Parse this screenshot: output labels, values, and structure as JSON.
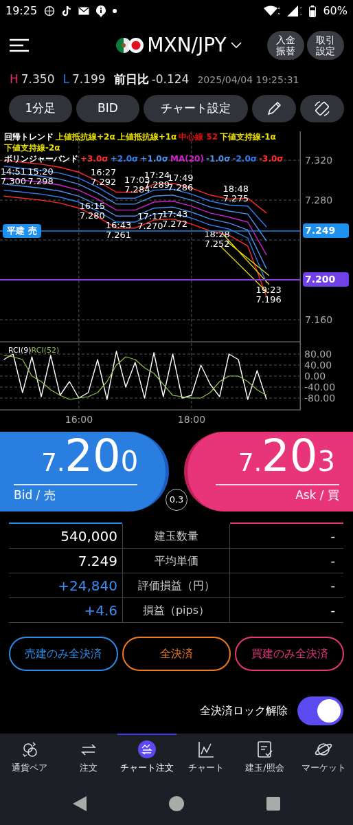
{
  "status_bar": {
    "time": "19:25",
    "battery": "60%"
  },
  "header": {
    "pair": "MXN/JPY",
    "buttons": [
      "入金振替",
      "取引設定"
    ]
  },
  "quote": {
    "high_label": "H",
    "high": "7.350",
    "low_label": "L",
    "low": "7.199",
    "change_label": "前日比",
    "change": "-0.124",
    "timestamp": "2025/04/04 19:25:31"
  },
  "toolbar": [
    {
      "kind": "text",
      "label": "1分足"
    },
    {
      "kind": "text",
      "label": "BID"
    },
    {
      "kind": "text",
      "label": "チャート設定"
    },
    {
      "kind": "pencil"
    },
    {
      "kind": "rotate"
    }
  ],
  "chart": {
    "legend_top": [
      {
        "text": "回帰トレンド",
        "color": "#ffffff"
      },
      {
        "text": "上値抵抗線+2α",
        "color": "#e8e000"
      },
      {
        "text": "上値抵抗線+1α",
        "color": "#e8e000"
      },
      {
        "text": "中心線 52",
        "color": "#e01010"
      },
      {
        "text": "下値支持線-1α",
        "color": "#e8e000"
      }
    ],
    "legend_second": {
      "text": "下値支持線-2α",
      "color": "#e8e000"
    },
    "bands_title": {
      "text": "ボリンジャーバンド",
      "color": "#ffffff"
    },
    "annotations": [
      {
        "kind": "high",
        "time": "14:51",
        "price": "7.300"
      },
      {
        "kind": "high",
        "time": "15:20",
        "price": "7.298"
      },
      {
        "kind": "high",
        "time": "16:27",
        "price": "7.292"
      },
      {
        "kind": "low",
        "time": "16:15",
        "price": "7.280"
      },
      {
        "kind": "low",
        "time": "16:43",
        "price": "7.261"
      },
      {
        "kind": "high",
        "time": "17:03",
        "price": "7.284"
      },
      {
        "kind": "high",
        "time": "17:24",
        "price": "7.289"
      },
      {
        "kind": "low",
        "time": "17:17",
        "price": "7.270"
      },
      {
        "kind": "high",
        "time": "17:49",
        "price": "7.286"
      },
      {
        "kind": "low",
        "time": "17:43",
        "price": "7.272"
      },
      {
        "kind": "high",
        "time": "18:48",
        "price": "7.275"
      },
      {
        "kind": "low",
        "time": "18:28",
        "price": "7.252"
      },
      {
        "kind": "low",
        "time": "19:23",
        "price": "7.196"
      }
    ],
    "price_chart": {
      "chart_data": {
        "type": "line",
        "xlim": [
          14.6,
          19.93
        ],
        "ylim": [
          7.138,
          7.349
        ],
        "x": [
          14.667,
          15,
          15.333,
          15.667,
          16,
          16.333,
          16.667,
          17,
          17.333,
          17.667,
          18,
          18.333,
          18.667,
          19,
          19.333
        ],
        "yticks": [
          {
            "value": 7.32,
            "label": "7.320"
          },
          {
            "value": 7.28,
            "label": "7.280"
          },
          {
            "value": 7.16,
            "label": "7.160"
          }
        ],
        "series": [
          {
            "name": "+3.0σ",
            "color": "#ff2a2a",
            "values": [
              7.32,
              7.318,
              7.316,
              7.313,
              7.308,
              7.299,
              7.288,
              7.288,
              7.296,
              7.297,
              7.292,
              7.285,
              7.281,
              7.282,
              7.267
            ]
          },
          {
            "name": "+2.0σ",
            "color": "#2f7df0",
            "values": [
              7.314,
              7.312,
              7.31,
              7.307,
              7.302,
              7.293,
              7.282,
              7.282,
              7.29,
              7.291,
              7.286,
              7.279,
              7.275,
              7.274,
              7.253
            ]
          },
          {
            "name": "+1.0σ",
            "color": "#4a90e8",
            "values": [
              7.308,
              7.306,
              7.304,
              7.301,
              7.296,
              7.287,
              7.276,
              7.276,
              7.284,
              7.285,
              7.28,
              7.273,
              7.269,
              7.266,
              7.239
            ]
          },
          {
            "name": "MA(20)",
            "color": "#d020d0",
            "values": [
              7.302,
              7.3,
              7.298,
              7.295,
              7.29,
              7.281,
              7.27,
              7.27,
              7.278,
              7.279,
              7.274,
              7.267,
              7.263,
              7.258,
              7.225
            ]
          },
          {
            "name": "-1.0σ",
            "color": "#4a90e8",
            "values": [
              7.296,
              7.294,
              7.292,
              7.289,
              7.284,
              7.275,
              7.264,
              7.264,
              7.272,
              7.273,
              7.268,
              7.261,
              7.257,
              7.25,
              7.211
            ]
          },
          {
            "name": "-2.0σ",
            "color": "#2f7df0",
            "values": [
              7.29,
              7.288,
              7.286,
              7.283,
              7.278,
              7.269,
              7.258,
              7.258,
              7.266,
              7.267,
              7.262,
              7.255,
              7.251,
              7.242,
              7.197
            ]
          },
          {
            "name": "-3.0σ",
            "color": "#ff2a2a",
            "values": [
              7.284,
              7.282,
              7.28,
              7.277,
              7.272,
              7.263,
              7.252,
              7.252,
              7.26,
              7.261,
              7.256,
              7.249,
              7.245,
              7.234,
              7.183
            ]
          }
        ]
      }
    },
    "position_line": {
      "label": "平建 売",
      "price": "7.249"
    },
    "current_price": "7.200",
    "rci_chart": {
      "chart_data": {
        "type": "line",
        "x": [
          14.667,
          14.833,
          15,
          15.167,
          15.333,
          15.5,
          15.667,
          15.833,
          16,
          16.167,
          16.333,
          16.5,
          16.667,
          16.833,
          17,
          17.167,
          17.333,
          17.5,
          17.667,
          17.833,
          18,
          18.167,
          18.333,
          18.5,
          18.667,
          18.833,
          19,
          19.167,
          19.333
        ],
        "xlim": [
          14.6,
          19.93
        ],
        "ylim": [
          -122.5,
          125
        ],
        "yticks": [
          {
            "value": 80,
            "label": "80.00"
          },
          {
            "value": 40,
            "label": "40.00"
          },
          {
            "value": 0,
            "label": "0.00"
          },
          {
            "value": -40,
            "label": "-40.00"
          },
          {
            "value": -80,
            "label": "-80.00"
          }
        ],
        "xticks": [
          {
            "value": 16,
            "label": "16:00"
          },
          {
            "value": 18,
            "label": "18:00"
          }
        ],
        "series": [
          {
            "name": "RCI(9)",
            "color": "#ffffff",
            "values": [
              60,
              80,
              -60,
              70,
              -75,
              75,
              -70,
              -20,
              -80,
              -60,
              60,
              -85,
              90,
              -40,
              50,
              -80,
              85,
              -75,
              80,
              -80,
              -70,
              40,
              -30,
              -75,
              80,
              60,
              -85,
              20,
              -85
            ]
          },
          {
            "name": "RCI(52)",
            "color": "#8fc048",
            "values": [
              75,
              70,
              60,
              0,
              -20,
              -50,
              -70,
              -85,
              -80,
              -75,
              -60,
              -20,
              40,
              70,
              60,
              30,
              10,
              -30,
              -70,
              -75,
              -80,
              -80,
              -60,
              -20,
              0,
              0,
              -20,
              -50,
              -70
            ]
          }
        ]
      }
    }
  },
  "bid": {
    "lead": "7.",
    "main": "20",
    "tail": "0",
    "label": "Bid / 売"
  },
  "spread": "0.3",
  "ask": {
    "lead": "7.",
    "main": "20",
    "tail": "3",
    "label": "Ask / 買"
  },
  "positions": [
    {
      "kind": "plain",
      "sell": "540,000",
      "label": "建玉数量",
      "buy": "-"
    },
    {
      "kind": "plain",
      "sell": "7.249",
      "label": "平均単価",
      "buy": "-"
    },
    {
      "kind": "profit",
      "sell": "+24,840",
      "label": "評価損益（円）",
      "buy": "-"
    },
    {
      "kind": "profit",
      "sell": "+4.6",
      "label": "損益（pips）",
      "buy": "-"
    }
  ],
  "close_buttons": [
    {
      "label": "売建のみ全決済",
      "color": "#2d8ce8"
    },
    {
      "label": "全決済",
      "color": "#f07a1e"
    },
    {
      "label": "買建のみ全決済",
      "color": "#e8357a"
    }
  ],
  "lock": {
    "label": "全決済ロック解除",
    "on": true
  },
  "nav": [
    {
      "kind": "pairs",
      "label": "通貨ペア",
      "selected": false
    },
    {
      "kind": "order",
      "label": "注文",
      "selected": false
    },
    {
      "kind": "chartorder",
      "label": "チャート注文",
      "selected": true
    },
    {
      "kind": "chart",
      "label": "チャート",
      "selected": false
    },
    {
      "kind": "positions",
      "label": "建玉/照会",
      "selected": false
    },
    {
      "kind": "market",
      "label": "マーケット",
      "selected": false
    }
  ]
}
